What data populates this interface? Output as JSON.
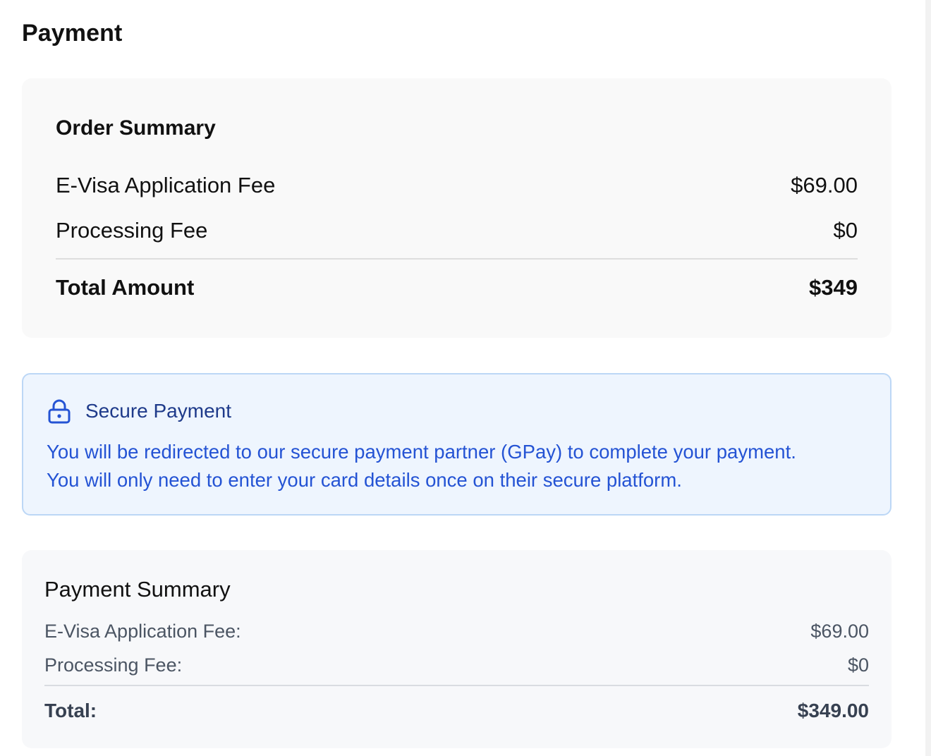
{
  "page": {
    "title": "Payment"
  },
  "order_summary": {
    "title": "Order Summary",
    "items": [
      {
        "label": "E-Visa Application Fee",
        "amount": "$69.00"
      },
      {
        "label": "Processing Fee",
        "amount": "$0"
      }
    ],
    "total": {
      "label": "Total Amount",
      "amount": "$349"
    }
  },
  "secure_payment": {
    "icon": "lock-icon",
    "title": "Secure Payment",
    "line1": "You will be redirected to our secure payment partner (GPay) to complete your payment.",
    "line2": "You will only need to enter your card details once on their secure platform."
  },
  "payment_summary": {
    "title": "Payment Summary",
    "items": [
      {
        "label": "E-Visa Application Fee:",
        "amount": "$69.00"
      },
      {
        "label": "Processing Fee:",
        "amount": "$0"
      }
    ],
    "total": {
      "label": "Total:",
      "amount": "$349.00"
    }
  },
  "colors": {
    "secure_bg": "#eef5fe",
    "secure_border": "#bcd7f6",
    "secure_title": "#1e3a8a",
    "secure_text": "#2453d4",
    "card_bg": "#f9f9f9"
  }
}
